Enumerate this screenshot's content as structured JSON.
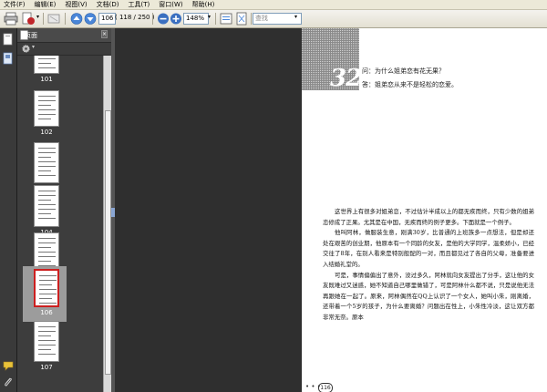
{
  "menu": {
    "items": [
      "文件(F)",
      "编辑(E)",
      "视图(V)",
      "文档(D)",
      "工具(T)",
      "窗口(W)",
      "帮助(H)"
    ]
  },
  "toolbar": {
    "page_input": "106",
    "page_count": "( 118 / 250 )",
    "zoom": "148%",
    "search_placeholder": "查找"
  },
  "sidebar": {
    "title": "页面",
    "thumbnails": [
      {
        "label": "101",
        "selected": false
      },
      {
        "label": "102",
        "selected": false
      },
      {
        "label": "103",
        "selected": false
      },
      {
        "label": "104",
        "selected": false
      },
      {
        "label": "105",
        "selected": false
      },
      {
        "label": "106",
        "selected": true
      },
      {
        "label": "107",
        "selected": false
      }
    ]
  },
  "document": {
    "chapter_number": "32",
    "question": "问：为什么姐弟恋有花无果？",
    "answer": "答：姐弟恋从来不是轻松的恋爱。",
    "paragraphs": [
      "这世界上有很多对姐弟恋，不过估计半成以上的都无疾而终，只有少数的姐弟恋修成了正果。尤其是在中国，无疾而终的例子更多。下面就是一个例子。",
      "他叫阿林，做服装生意，刚满30岁，比普通的上班族多一点想法，但是却还处在艰苦的创业期，他原本有一个同龄的女友，是他的大学同学，温柔娇小，已经交往了8年，在别人看来是特别般配的一对，而且都见过了各自的父母，准备要进入结婚礼堂的。",
      "可是，事情偏偏出了意外，没过多久，阿林就向女友提出了分手，这让他的女友既难过又迷惑，她不知道自己哪里做错了，可是阿林什么都不说，只是说他无法再跟她在一起了。原来，阿林偶然在QQ上认识了一个女人，她叫小朱，刚离婚，还带着一个5岁的孩子，为什么要离婚？问题出在性上，小朱性冷淡，这让双方都非常无奈。原本"
    ],
    "folio": "116"
  },
  "colors": {
    "menubar_bg": "#ece9d8",
    "sidebar_bg": "#3d3d3d",
    "selection_red": "#cc1f1f",
    "zoom_blue": "#3a6fc0"
  }
}
